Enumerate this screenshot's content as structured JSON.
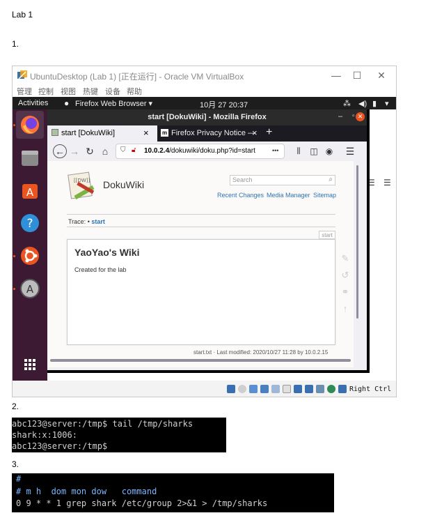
{
  "doc": {
    "heading": "Lab 1",
    "item1": "1.",
    "item2": "2.",
    "item3": "3."
  },
  "vbox": {
    "title": "UbuntuDesktop (Lab 1) [正在运行] - Oracle VM VirtualBox",
    "menu": [
      "管理",
      "控制",
      "视图",
      "热键",
      "设备",
      "帮助"
    ],
    "host_key": "Right Ctrl"
  },
  "ubuntu": {
    "activities": "Activities",
    "app_menu": "Firefox Web Browser ▾",
    "clock": "10月 27 20:37",
    "dock": [
      "firefox-icon",
      "files-icon",
      "software-icon",
      "help-icon",
      "ubuntu-icon",
      "updater-icon",
      "app-grid-icon"
    ]
  },
  "firefox": {
    "window_title": "start [DokuWiki] - Mozilla Firefox",
    "tabs": [
      {
        "label": "start [DokuWiki]"
      },
      {
        "label": "Firefox Privacy Notice —"
      }
    ],
    "url_host": "10.0.2.4",
    "url_path": "/dokuwiki/doku.php?id=start",
    "url_more": "•••"
  },
  "dokuwiki": {
    "site_title": "DokuWiki",
    "search_placeholder": "Search",
    "links": {
      "recent": "Recent Changes",
      "media": "Media Manager",
      "sitemap": "Sitemap"
    },
    "trace_label": "Trace:",
    "trace_sep": "•",
    "trace_link": "start",
    "page_tab": "start",
    "page_heading": "YaoYao's Wiki",
    "page_text": "Created for the lab",
    "footer": "start.txt · Last modified: 2020/10/27 11:28 by 10.0.2.15"
  },
  "terminal1": {
    "lines": [
      "abc123@server:/tmp$ tail /tmp/sharks",
      "shark:x:1006:",
      "abc123@server:/tmp$"
    ]
  },
  "terminal2": {
    "lines": [
      "#",
      "# m h  dom mon dow   command",
      "0 9 * * 1 grep shark /etc/group 2>&1 > /tmp/sharks"
    ]
  },
  "colors": {
    "ubuntu_dock": "#3c1a33",
    "ubuntu_orange": "#e95420",
    "link_blue": "#2b73b7",
    "terminal_bg": "#000000"
  }
}
